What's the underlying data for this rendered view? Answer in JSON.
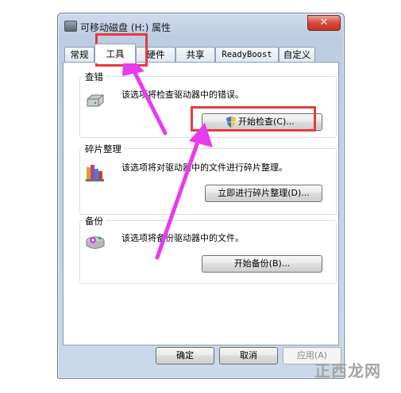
{
  "window": {
    "title": "可移动磁盘 (H:) 属性",
    "close_glyph": "✕"
  },
  "tabs": [
    {
      "label": "常规"
    },
    {
      "label": "工具",
      "active": true
    },
    {
      "label": "硬件"
    },
    {
      "label": "共享"
    },
    {
      "label": "ReadyBoost"
    },
    {
      "label": "自定义"
    }
  ],
  "sections": {
    "error_check": {
      "title": "查错",
      "description": "该选项将检查驱动器中的错误。",
      "button": "开始检查(C)..."
    },
    "defrag": {
      "title": "碎片整理",
      "description": "该选项将对驱动器中的文件进行碎片整理。",
      "button": "立即进行碎片整理(D)..."
    },
    "backup": {
      "title": "备份",
      "description": "该选项将备份驱动器中的文件。",
      "button": "开始备份(B)..."
    }
  },
  "footer": {
    "ok": "确定",
    "cancel": "取消",
    "apply": "应用(A)"
  },
  "watermark": "正西龙网",
  "colors": {
    "highlight": "#e53b3b",
    "arrow": "#e83aef"
  }
}
